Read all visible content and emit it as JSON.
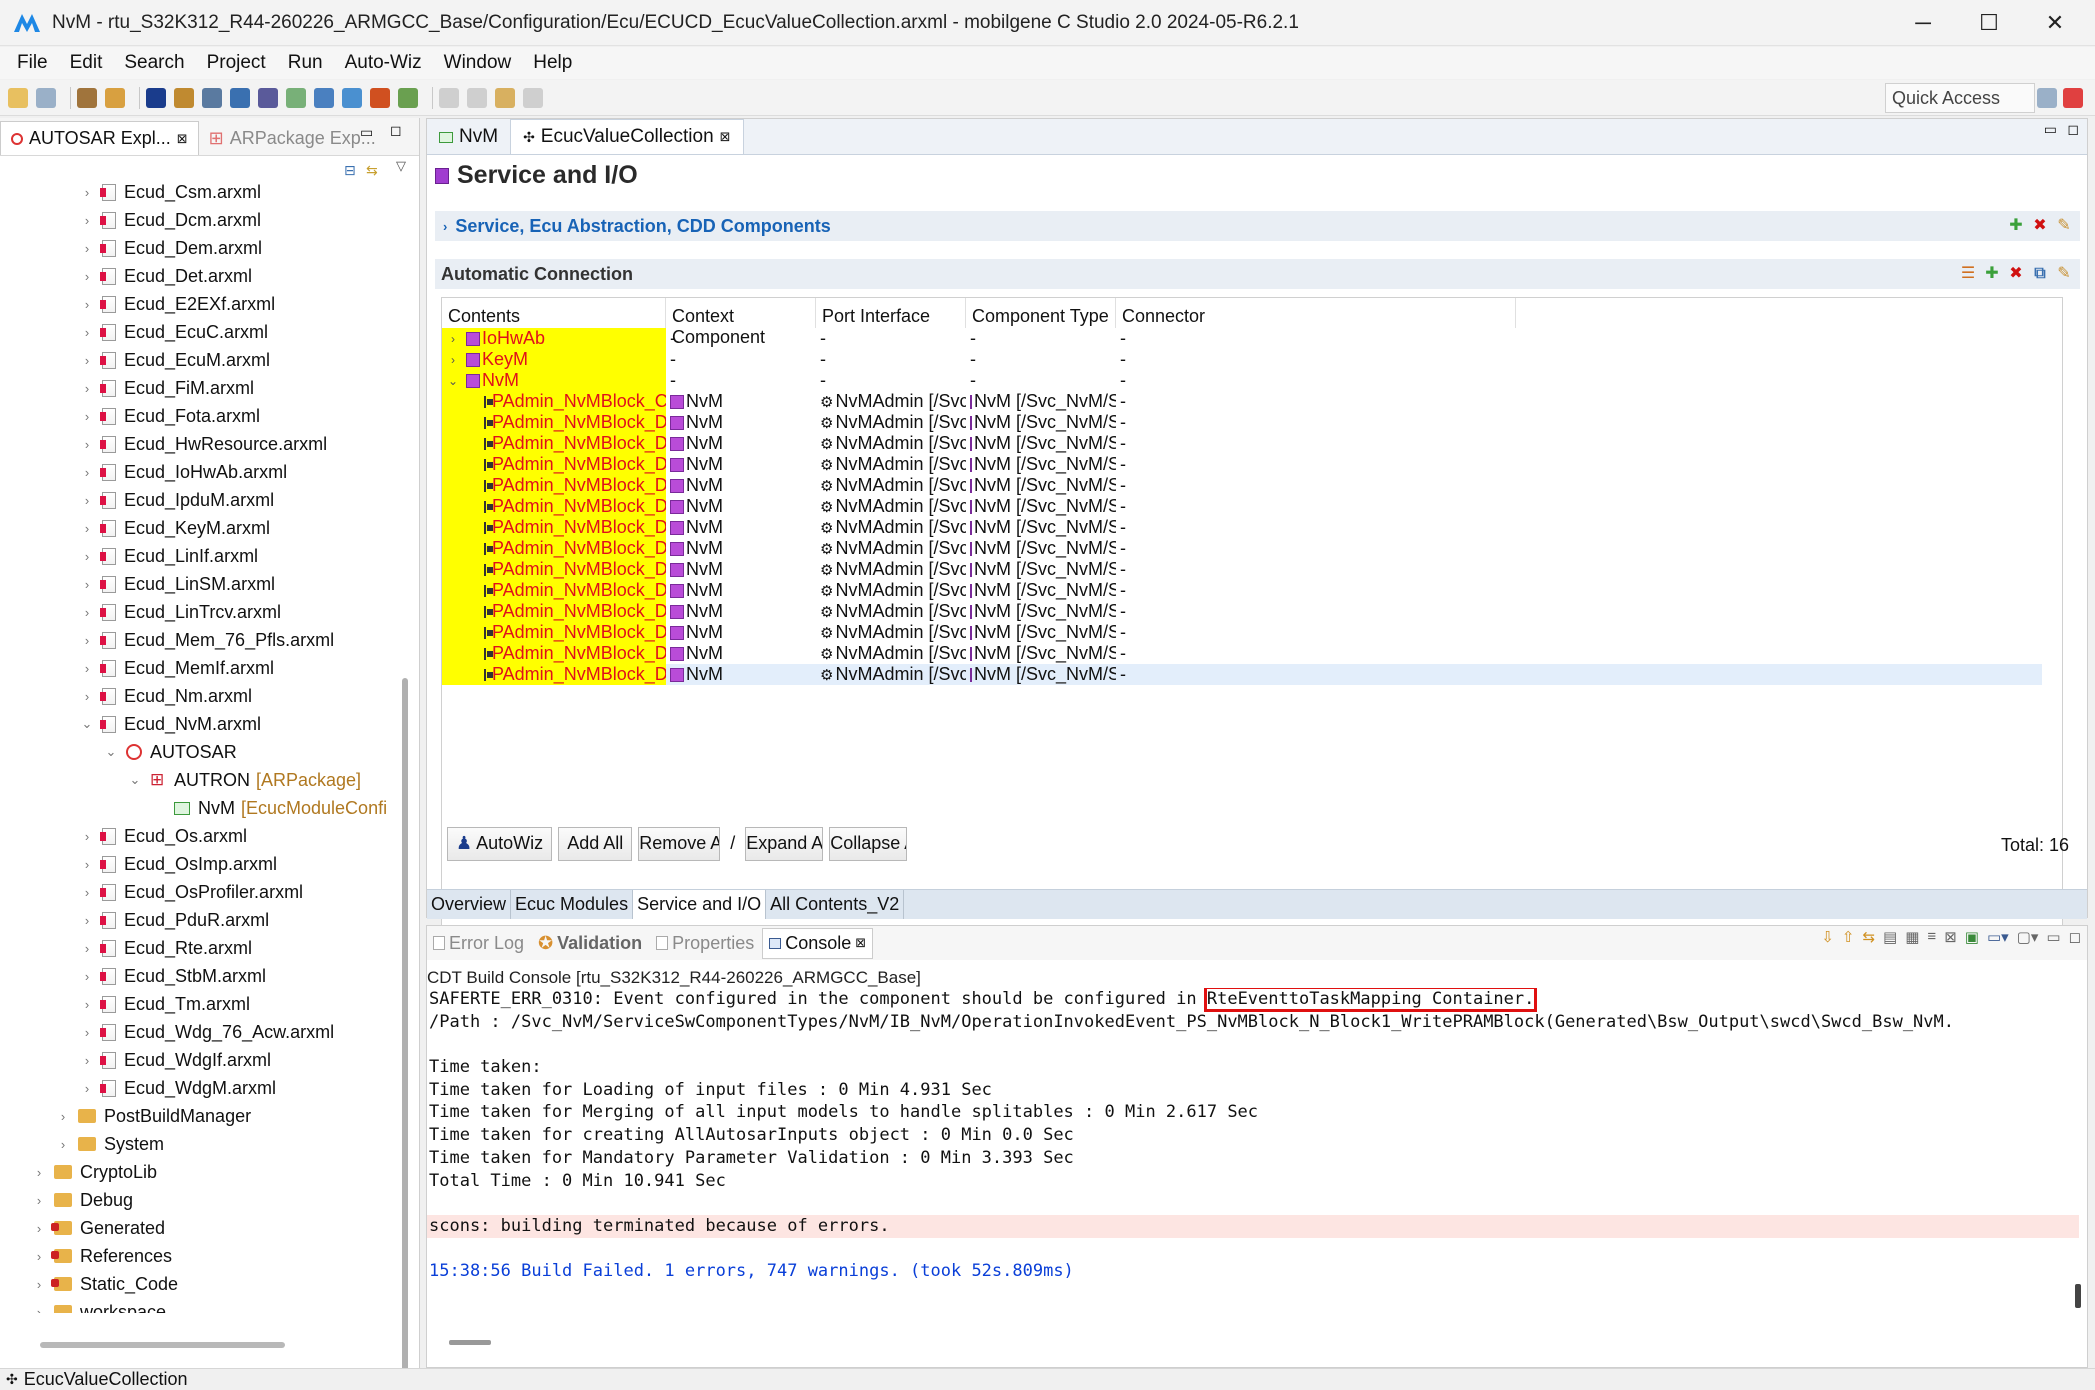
{
  "window": {
    "title": "NvM - rtu_S32K312_R44-260226_ARMGCC_Base/Configuration/Ecu/ECUCD_EcucValueCollection.arxml - mobilgene C Studio 2.0 2024-05-R6.2.1",
    "minimize": "─",
    "maximize": "☐",
    "close": "✕"
  },
  "menu": [
    "File",
    "Edit",
    "Search",
    "Project",
    "Run",
    "Auto-Wiz",
    "Window",
    "Help"
  ],
  "toolbar": {
    "quick_access": "Quick Access"
  },
  "left_panel": {
    "tabs": [
      {
        "label": "AUTOSAR Expl...",
        "close": "⊠"
      },
      {
        "label": "ARPackage Exp..."
      }
    ],
    "tree": [
      {
        "label": "Ecud_Csm.arxml",
        "indent": 4,
        "icon": "file",
        "twisty": "›"
      },
      {
        "label": "Ecud_Dcm.arxml",
        "indent": 4,
        "icon": "file",
        "twisty": "›"
      },
      {
        "label": "Ecud_Dem.arxml",
        "indent": 4,
        "icon": "file",
        "twisty": "›"
      },
      {
        "label": "Ecud_Det.arxml",
        "indent": 4,
        "icon": "file",
        "twisty": "›"
      },
      {
        "label": "Ecud_E2EXf.arxml",
        "indent": 4,
        "icon": "file",
        "twisty": "›"
      },
      {
        "label": "Ecud_EcuC.arxml",
        "indent": 4,
        "icon": "file",
        "twisty": "›"
      },
      {
        "label": "Ecud_EcuM.arxml",
        "indent": 4,
        "icon": "file",
        "twisty": "›"
      },
      {
        "label": "Ecud_FiM.arxml",
        "indent": 4,
        "icon": "file",
        "twisty": "›"
      },
      {
        "label": "Ecud_Fota.arxml",
        "indent": 4,
        "icon": "file",
        "twisty": "›"
      },
      {
        "label": "Ecud_HwResource.arxml",
        "indent": 4,
        "icon": "file",
        "twisty": "›"
      },
      {
        "label": "Ecud_IoHwAb.arxml",
        "indent": 4,
        "icon": "file",
        "twisty": "›"
      },
      {
        "label": "Ecud_IpduM.arxml",
        "indent": 4,
        "icon": "file",
        "twisty": "›"
      },
      {
        "label": "Ecud_KeyM.arxml",
        "indent": 4,
        "icon": "file",
        "twisty": "›"
      },
      {
        "label": "Ecud_LinIf.arxml",
        "indent": 4,
        "icon": "file",
        "twisty": "›"
      },
      {
        "label": "Ecud_LinSM.arxml",
        "indent": 4,
        "icon": "file",
        "twisty": "›"
      },
      {
        "label": "Ecud_LinTrcv.arxml",
        "indent": 4,
        "icon": "file",
        "twisty": "›"
      },
      {
        "label": "Ecud_Mem_76_Pfls.arxml",
        "indent": 4,
        "icon": "file",
        "twisty": "›"
      },
      {
        "label": "Ecud_MemIf.arxml",
        "indent": 4,
        "icon": "file",
        "twisty": "›"
      },
      {
        "label": "Ecud_Nm.arxml",
        "indent": 4,
        "icon": "file",
        "twisty": "›"
      },
      {
        "label": "Ecud_NvM.arxml",
        "indent": 4,
        "icon": "file",
        "twisty": "⌄"
      },
      {
        "label": "AUTOSAR",
        "indent": 5,
        "icon": "autosar",
        "twisty": "⌄"
      },
      {
        "label": "AUTRON",
        "suffix": "[ARPackage]",
        "indent": 6,
        "icon": "pkg",
        "twisty": "⌄"
      },
      {
        "label": "NvM",
        "suffix": "[EcucModuleConfi",
        "indent": 7,
        "icon": "nvm",
        "twisty": ""
      },
      {
        "label": "Ecud_Os.arxml",
        "indent": 4,
        "icon": "file",
        "twisty": "›"
      },
      {
        "label": "Ecud_OsImp.arxml",
        "indent": 4,
        "icon": "file",
        "twisty": "›"
      },
      {
        "label": "Ecud_OsProfiler.arxml",
        "indent": 4,
        "icon": "file",
        "twisty": "›"
      },
      {
        "label": "Ecud_PduR.arxml",
        "indent": 4,
        "icon": "file",
        "twisty": "›"
      },
      {
        "label": "Ecud_Rte.arxml",
        "indent": 4,
        "icon": "file",
        "twisty": "›"
      },
      {
        "label": "Ecud_StbM.arxml",
        "indent": 4,
        "icon": "file",
        "twisty": "›"
      },
      {
        "label": "Ecud_Tm.arxml",
        "indent": 4,
        "icon": "file",
        "twisty": "›"
      },
      {
        "label": "Ecud_Wdg_76_Acw.arxml",
        "indent": 4,
        "icon": "file",
        "twisty": "›"
      },
      {
        "label": "Ecud_WdgIf.arxml",
        "indent": 4,
        "icon": "file",
        "twisty": "›"
      },
      {
        "label": "Ecud_WdgM.arxml",
        "indent": 4,
        "icon": "file",
        "twisty": "›"
      },
      {
        "label": "PostBuildManager",
        "indent": 3,
        "icon": "folder",
        "twisty": "›"
      },
      {
        "label": "System",
        "indent": 3,
        "icon": "folder",
        "twisty": "›"
      },
      {
        "label": "CryptoLib",
        "indent": 2,
        "icon": "folder",
        "twisty": "›"
      },
      {
        "label": "Debug",
        "indent": 2,
        "icon": "folder",
        "twisty": "›"
      },
      {
        "label": "Generated",
        "indent": 2,
        "icon": "folder-red",
        "twisty": "›"
      },
      {
        "label": "References",
        "indent": 2,
        "icon": "folder-red",
        "twisty": "›"
      },
      {
        "label": "Static_Code",
        "indent": 2,
        "icon": "folder-red",
        "twisty": "›"
      },
      {
        "label": "workspace",
        "indent": 2,
        "icon": "folder",
        "twisty": "›"
      }
    ]
  },
  "editor": {
    "tabs": [
      {
        "label": "NvM"
      },
      {
        "label": "EcucValueCollection",
        "close": "⊠"
      }
    ],
    "title": "Service and I/O",
    "section_service": "Service, Ecu Abstraction, CDD Components",
    "section_auto": "Automatic Connection",
    "columns": [
      "Contents",
      "Context Component",
      "Port Interface",
      "Component Type",
      "Connector"
    ],
    "rows": [
      {
        "content": "IoHwAb",
        "level": 0,
        "twisty": "›",
        "ctx": "-",
        "port": "-",
        "type": "-",
        "conn": "-"
      },
      {
        "content": "KeyM",
        "level": 0,
        "twisty": "›",
        "ctx": "-",
        "port": "-",
        "type": "-",
        "conn": "-"
      },
      {
        "content": "NvM",
        "level": 0,
        "twisty": "⌄",
        "ctx": "-",
        "port": "-",
        "type": "-",
        "conn": "-"
      },
      {
        "content": "PAdmin_NvMBlock_ConfigID",
        "level": 1,
        "ctx": "NvM",
        "port": "NvMAdmin [/Svc_N...",
        "type": "NvM [/Svc_NvM/Se...",
        "conn": "-"
      },
      {
        "content": "PAdmin_NvMBlock_DemEve",
        "level": 1,
        "ctx": "NvM",
        "port": "NvMAdmin [/Svc_N...",
        "type": "NvM [/Svc_NvM/Se...",
        "conn": "-"
      },
      {
        "content": "PAdmin_NvMBlock_DemMir",
        "level": 1,
        "ctx": "NvM",
        "port": "NvMAdmin [/Svc_N...",
        "type": "NvM [/Svc_NvM/Se...",
        "conn": "-"
      },
      {
        "content": "PAdmin_NvMBlock_DemMir",
        "level": 1,
        "ctx": "NvM",
        "port": "NvMAdmin [/Svc_N...",
        "type": "NvM [/Svc_NvM/Se...",
        "conn": "-"
      },
      {
        "content": "PAdmin_NvMBlock_DemMir",
        "level": 1,
        "ctx": "NvM",
        "port": "NvMAdmin [/Svc_N...",
        "type": "NvM [/Svc_NvM/Se...",
        "conn": "-"
      },
      {
        "content": "PAdmin_NvMBlock_DemNo",
        "level": 1,
        "ctx": "NvM",
        "port": "NvMAdmin [/Svc_N...",
        "type": "NvM [/Svc_NvM/Se...",
        "conn": "-"
      },
      {
        "content": "PAdmin_NvMBlock_DemPer",
        "level": 1,
        "ctx": "NvM",
        "port": "NvMAdmin [/Svc_N...",
        "type": "NvM [/Svc_NvM/Se...",
        "conn": "-"
      },
      {
        "content": "PAdmin_NvMBlock_DemPer",
        "level": 1,
        "ctx": "NvM",
        "port": "NvMAdmin [/Svc_N...",
        "type": "NvM [/Svc_NvM/Se...",
        "conn": "-"
      },
      {
        "content": "PAdmin_NvMBlock_DemPer",
        "level": 1,
        "ctx": "NvM",
        "port": "NvMAdmin [/Svc_N...",
        "type": "NvM [/Svc_NvM/Se...",
        "conn": "-"
      },
      {
        "content": "PAdmin_NvMBlock_DemPri",
        "level": 1,
        "ctx": "NvM",
        "port": "NvMAdmin [/Svc_N...",
        "type": "NvM [/Svc_NvM/Se...",
        "conn": "-"
      },
      {
        "content": "PAdmin_NvMBlock_DemPri",
        "level": 1,
        "ctx": "NvM",
        "port": "NvMAdmin [/Svc_N...",
        "type": "NvM [/Svc_NvM/Se...",
        "conn": "-"
      },
      {
        "content": "PAdmin_NvMBlock_DemPri",
        "level": 1,
        "ctx": "NvM",
        "port": "NvMAdmin [/Svc_N...",
        "type": "NvM [/Svc_NvM/Se...",
        "conn": "-"
      },
      {
        "content": "PAdmin_NvMBlock_DemUse",
        "level": 1,
        "ctx": "NvM",
        "port": "NvMAdmin [/Svc_N...",
        "type": "NvM [/Svc_NvM/Se...",
        "conn": "-"
      },
      {
        "content": "PAdmin_NvMBlock_DemUse",
        "level": 1,
        "ctx": "NvM",
        "port": "NvMAdmin [/Svc_N...",
        "type": "NvM [/Svc_NvM/Se...",
        "conn": "-",
        "selected": true
      }
    ],
    "buttons": [
      "AutoWiz",
      "Add All",
      "Remove A",
      "/",
      "Expand Al",
      "Collapse A"
    ],
    "total": "Total: 16",
    "bottom_tabs": [
      "Overview",
      "Ecuc Modules",
      "Service and I/O",
      "All Contents_V2"
    ]
  },
  "console": {
    "tabs": [
      {
        "label": "Error Log"
      },
      {
        "label": "Validation"
      },
      {
        "label": "Properties"
      },
      {
        "label": "Console",
        "close": "⊠"
      }
    ],
    "subtitle": "CDT Build Console [rtu_S32K312_R44-260226_ARMGCC_Base]",
    "error_prefix": "SAFERTE_ERR_0310: Event configured in the component should be configured in ",
    "error_highlight": "RteEventtoTaskMapping Container.",
    "lines": [
      "/Path : /Svc_NvM/ServiceSwComponentTypes/NvM/IB_NvM/OperationInvokedEvent_PS_NvMBlock_N_Block1_WritePRAMBlock(Generated\\Bsw_Output\\swcd\\Swcd_Bsw_NvM.",
      "",
      "Time taken:",
      "Time taken for Loading of input files : 0 Min 4.931 Sec",
      "Time taken for Merging of all input models to handle splitables : 0 Min 2.617 Sec",
      "Time taken for creating AllAutosarInputs object : 0 Min 0.0 Sec",
      "Time taken for Mandatory Parameter Validation : 0 Min 3.393 Sec",
      "Total Time : 0 Min 10.941 Sec",
      ""
    ],
    "scons_error": "scons: building terminated because of errors.",
    "build_result": "15:38:56 Build Failed. 1 errors, 747 warnings. (took 52s.809ms)"
  },
  "statusbar": {
    "label": "EcucValueCollection"
  },
  "colors": {
    "highlight": "#ffff00",
    "content_text": "#e0101b",
    "error_box": "#e01010",
    "build_failed": "#0a3fd8"
  }
}
